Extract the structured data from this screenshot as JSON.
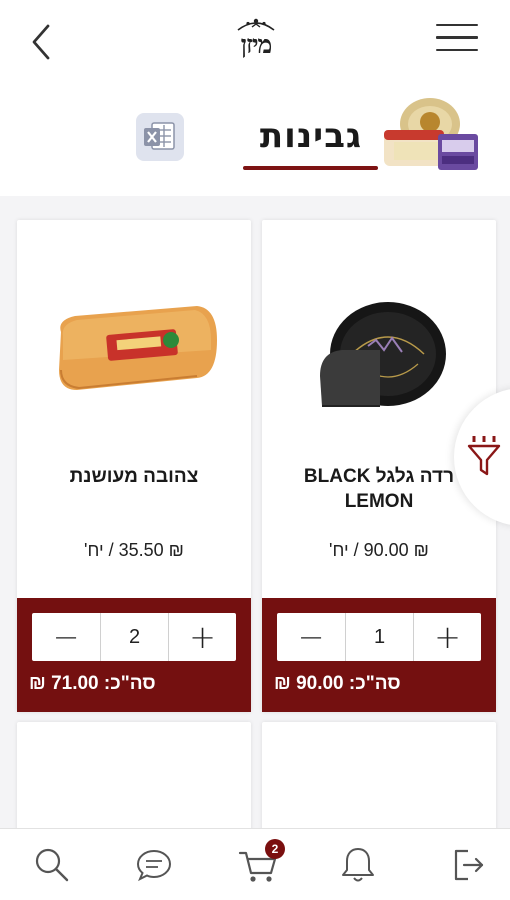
{
  "header": {
    "logo_text": "מיזן",
    "back_icon": "chevron-left-icon",
    "menu_icon": "hamburger-menu-icon"
  },
  "category": {
    "title": "גבינות",
    "export_icon": "excel-export-icon",
    "underline_color": "#7d1313"
  },
  "products": [
    {
      "name": "צהובה מעושנת",
      "price": "₪ 35.50 / יח'",
      "quantity": "2",
      "total": "סה\"כ: 71.00 ₪",
      "image": "smoked-yellow-cheese-block"
    },
    {
      "name": "רדה גלגל BLACK LEMON",
      "price": "₪ 90.00 / יח'",
      "quantity": "1",
      "total": "סה\"כ: 90.00 ₪",
      "image": "black-lemon-cheese-wheel"
    }
  ],
  "stepper": {
    "minus": "−",
    "plus": "+"
  },
  "filter": {
    "icon": "filter-funnel-icon"
  },
  "bottom_nav": {
    "items": [
      "search-icon",
      "chat-icon",
      "cart-icon",
      "bell-icon",
      "logout-icon"
    ],
    "cart_badge": "2"
  },
  "colors": {
    "brand": "#741010",
    "background": "#f4f4f6"
  }
}
